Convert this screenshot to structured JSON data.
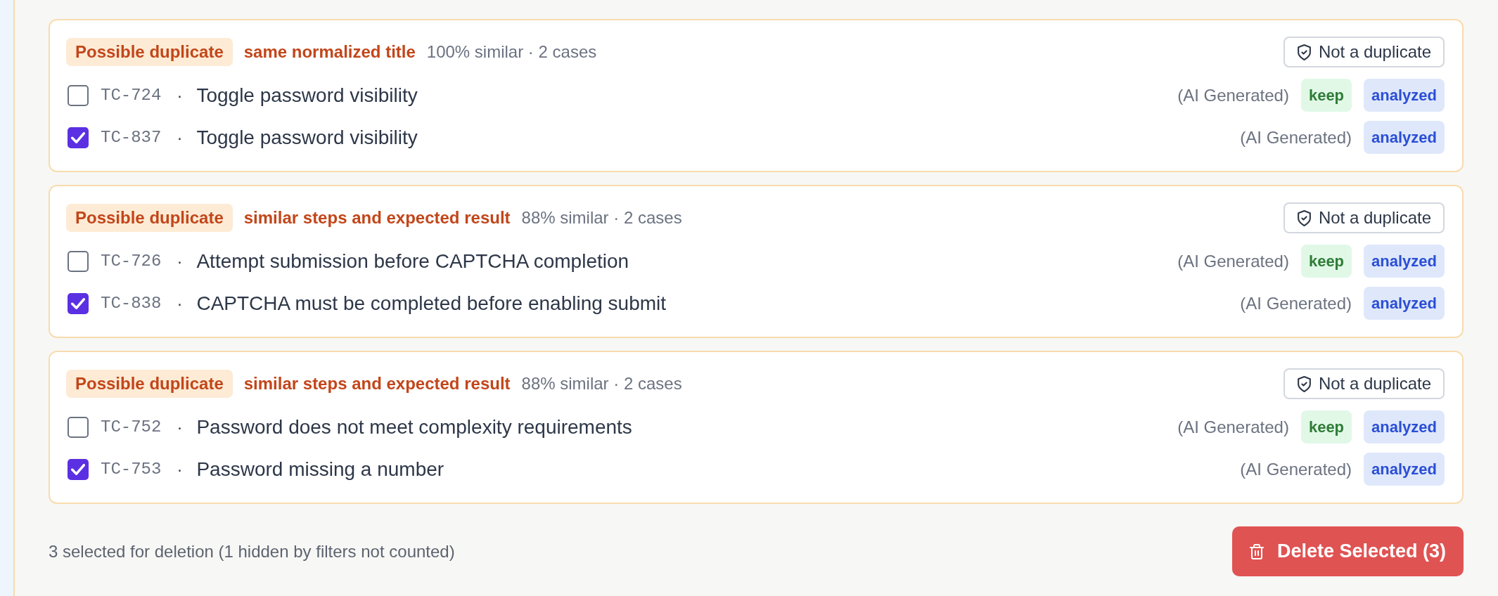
{
  "duplicate_groups": [
    {
      "badge": "Possible duplicate",
      "reason": "same normalized title",
      "similarity": "100% similar · 2 cases",
      "dismiss_button": {
        "label": "Not a duplicate"
      },
      "cases": [
        {
          "checked": false,
          "id": "TC-724",
          "separator": "·",
          "title": "Toggle password visibility",
          "source": "(AI Generated)",
          "tags": [
            {
              "kind": "keep",
              "label": "keep"
            },
            {
              "kind": "status",
              "label": "analyzed"
            }
          ]
        },
        {
          "checked": true,
          "id": "TC-837",
          "separator": "·",
          "title": "Toggle password visibility",
          "source": "(AI Generated)",
          "tags": [
            {
              "kind": "status",
              "label": "analyzed"
            }
          ]
        }
      ]
    },
    {
      "badge": "Possible duplicate",
      "reason": "similar steps and expected result",
      "similarity": "88% similar · 2 cases",
      "dismiss_button": {
        "label": "Not a duplicate"
      },
      "cases": [
        {
          "checked": false,
          "id": "TC-726",
          "separator": "·",
          "title": "Attempt submission before CAPTCHA completion",
          "source": "(AI Generated)",
          "tags": [
            {
              "kind": "keep",
              "label": "keep"
            },
            {
              "kind": "status",
              "label": "analyzed"
            }
          ]
        },
        {
          "checked": true,
          "id": "TC-838",
          "separator": "·",
          "title": "CAPTCHA must be completed before enabling submit",
          "source": "(AI Generated)",
          "tags": [
            {
              "kind": "status",
              "label": "analyzed"
            }
          ]
        }
      ]
    },
    {
      "badge": "Possible duplicate",
      "reason": "similar steps and expected result",
      "similarity": "88% similar · 2 cases",
      "dismiss_button": {
        "label": "Not a duplicate"
      },
      "cases": [
        {
          "checked": false,
          "id": "TC-752",
          "separator": "·",
          "title": "Password does not meet complexity requirements",
          "source": "(AI Generated)",
          "tags": [
            {
              "kind": "keep",
              "label": "keep"
            },
            {
              "kind": "status",
              "label": "analyzed"
            }
          ]
        },
        {
          "checked": true,
          "id": "TC-753",
          "separator": "·",
          "title": "Password missing a number",
          "source": "(AI Generated)",
          "tags": [
            {
              "kind": "status",
              "label": "analyzed"
            }
          ]
        }
      ]
    }
  ],
  "footer": {
    "summary": "3 selected for deletion (1 hidden by filters not counted)",
    "delete_button": {
      "label": "Delete Selected (3)"
    }
  }
}
